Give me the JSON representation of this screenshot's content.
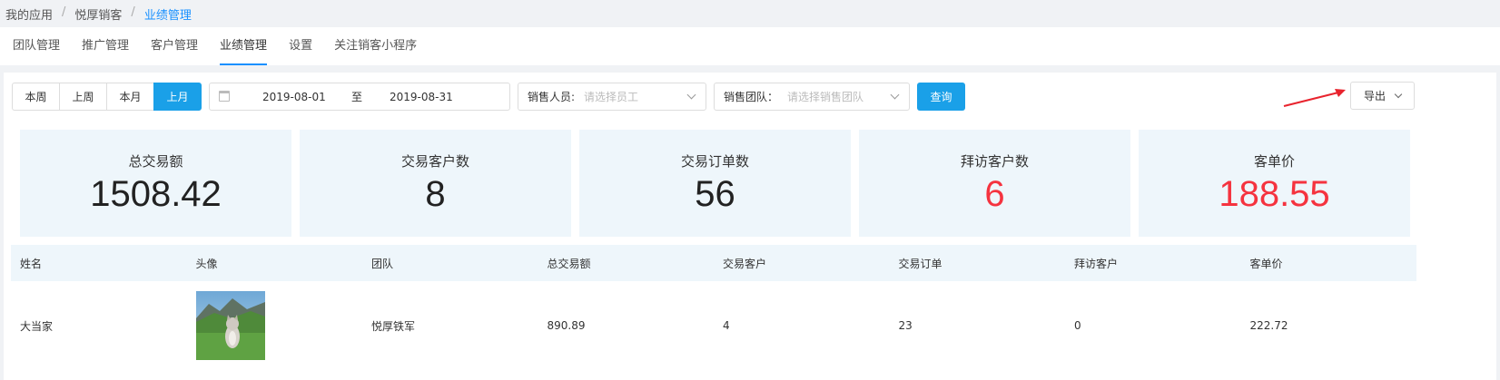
{
  "breadcrumb": {
    "item1": "我的应用",
    "item2": "悦厚销客",
    "item3": "业绩管理",
    "sep": "/"
  },
  "tabs": [
    "团队管理",
    "推广管理",
    "客户管理",
    "业绩管理",
    "设置",
    "关注销客小程序"
  ],
  "active_tab_index": 3,
  "filters": {
    "periods": [
      "本周",
      "上周",
      "本月",
      "上月"
    ],
    "active_period_index": 3,
    "date_start": "2019-08-01",
    "date_to": "至",
    "date_end": "2019-08-31",
    "sales_label": "销售人员:",
    "sales_placeholder": "请选择员工",
    "team_label": "销售团队：",
    "team_placeholder": "请选择销售团队",
    "query_label": "查询",
    "export_label": "导出"
  },
  "stats": [
    {
      "label": "总交易额",
      "value": "1508.42"
    },
    {
      "label": "交易客户数",
      "value": "8"
    },
    {
      "label": "交易订单数",
      "value": "56"
    },
    {
      "label": "拜访客户数",
      "value": "6"
    },
    {
      "label": "客单价",
      "value": "188.55"
    }
  ],
  "highlight_color": "#f5333f",
  "accent_color": "#1aa0e8",
  "table": {
    "headers": [
      "姓名",
      "头像",
      "团队",
      "总交易额",
      "交易客户",
      "交易订单",
      "拜访客户",
      "客单价"
    ],
    "rows": [
      {
        "name": "大当家",
        "team": "悦厚铁军",
        "total": "890.89",
        "customers": "4",
        "orders": "23",
        "visits": "0",
        "unit_price": "222.72"
      }
    ]
  }
}
